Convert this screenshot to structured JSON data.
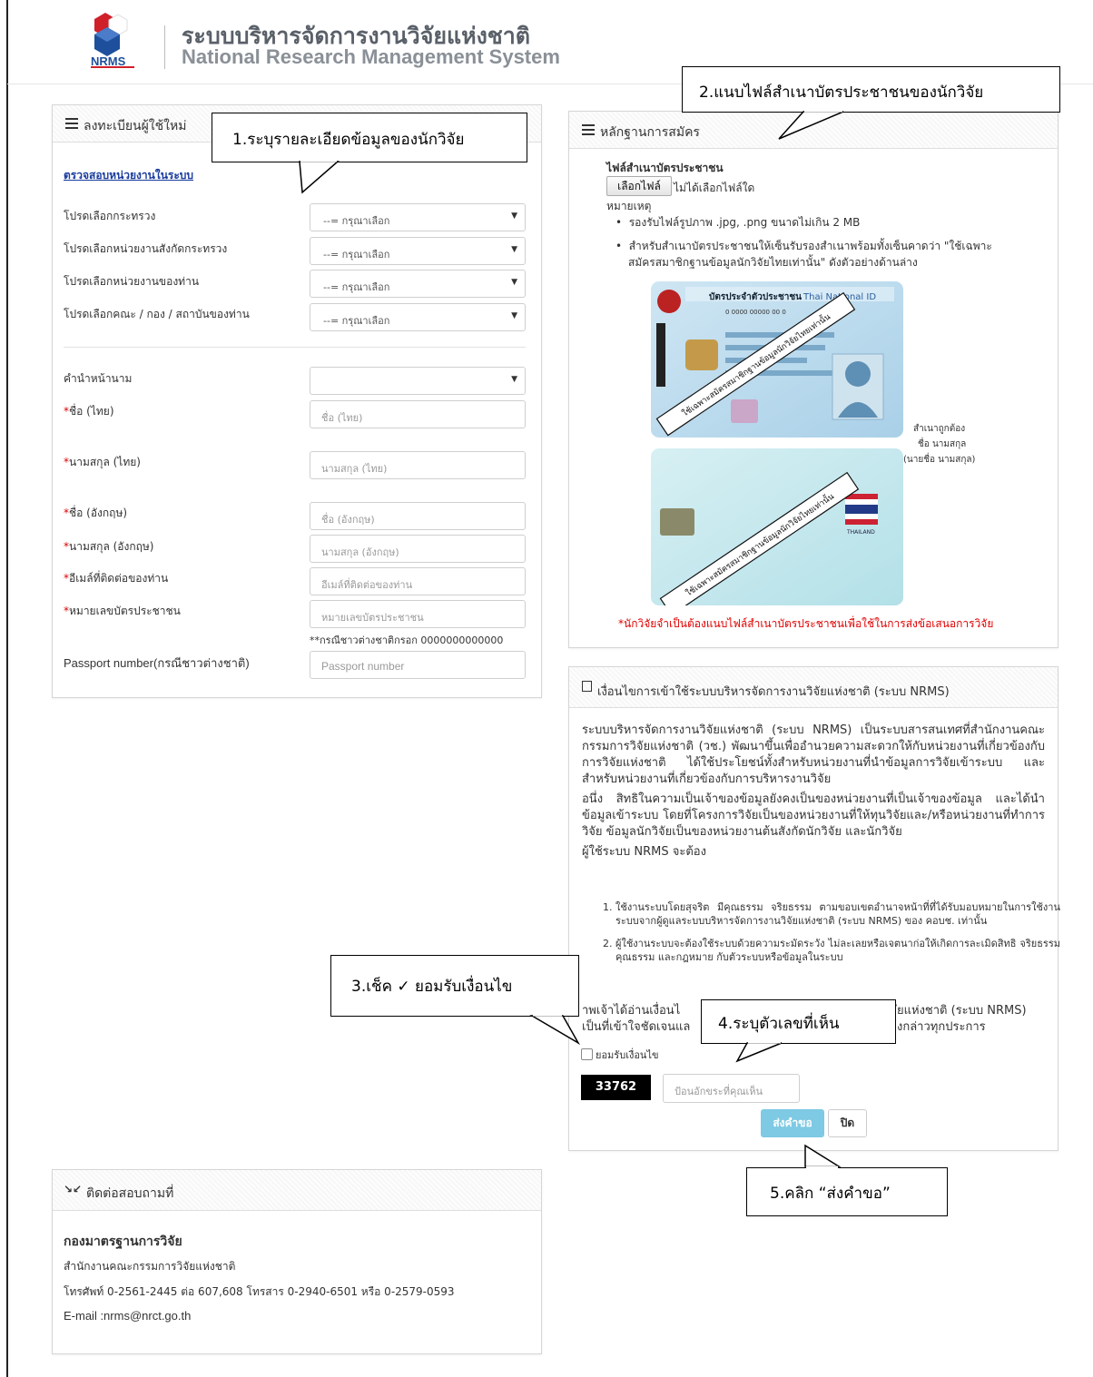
{
  "header": {
    "logo_text": "NRMS",
    "title_th": "ระบบบริหารจัดการงานวิจัยแห่งชาติ",
    "title_en": "National Research Management System"
  },
  "register": {
    "title": "ลงทะเบียนผู้ใช้ใหม่",
    "check_link": "ตรวจสอบหน่วยงานในระบบ",
    "placeholder_select": "--= กรุณาเลือก",
    "ministry_label": "โปรดเลือกกระทรวง",
    "agency_label": "โปรดเลือกหน่วยงานสังกัดกระทรวง",
    "unit_label": "โปรดเลือกหน่วยงานของท่าน",
    "faculty_label": "โปรดเลือกคณะ / กอง / สถาบันของท่าน",
    "prefix_label": "คำนำหน้านาม",
    "required_mark": "*",
    "name_th_label": "ชื่อ (ไทย)",
    "name_th_placeholder": "ชื่อ (ไทย)",
    "surname_th_label": "นามสกุล (ไทย)",
    "surname_th_placeholder": "นามสกุล (ไทย)",
    "name_en_label": "ชื่อ (อังกฤษ)",
    "name_en_placeholder": "ชื่อ (อังกฤษ)",
    "surname_en_label": "นามสกุล (อังกฤษ)",
    "surname_en_placeholder": "นามสกุล (อังกฤษ)",
    "email_label": "อีเมล์ที่ติดต่อของท่าน",
    "email_placeholder": "อีเมล์ที่ติดต่อของท่าน",
    "id_label": "หมายเลขบัตรประชาชน",
    "id_placeholder": "หมายเลขบัตรประชาชน",
    "foreigner_note": "**กรณีชาวต่างชาติกรอก 0000000000000",
    "passport_label": "Passport number(กรณีชาวต่างชาติ)",
    "passport_placeholder": "Passport number"
  },
  "evidence": {
    "title": "หลักฐานการสมัคร",
    "file_label": "ไฟล์สำเนาบัตรประชาชน",
    "choose_file": "เลือกไฟล์",
    "no_file": "ไม่ได้เลือกไฟล์ใด",
    "note_label": "หมายเหตุ",
    "bullet1": "รองรับไฟล์รูปภาพ .jpg, .png ขนาดไม่เกิน 2 MB",
    "bullet2_line1": "สำหรับสำเนาบัตรประชาชนให้เซ็นรับรองสำเนาพร้อมทั้งเซ็นคาดว่า \"ใช้เฉพาะ",
    "bullet2_line2": "สมัครสมาชิกฐานข้อมูลนักวิจัยไทยเท่านั้น\" ดังตัวอย่างด้านล่าง",
    "card_title_th": "บัตรประจำตัวประชาชน",
    "card_title_en": "Thai National ID",
    "card_number": "0 0000 00000 00 0",
    "card_stamp_text": "ใช้เฉพาะสมัครสมาชิกฐานข้อมูลนักวิจัยไทยเท่านั้น",
    "card_country": "THAILAND",
    "sign_line1": "สำเนาถูกต้อง",
    "sign_line2": "ชื่อ นามสกุล",
    "sign_line3": "(นายชื่อ นามสกุล)",
    "warning": "*นักวิจัยจำเป็นต้องแนบไฟล์สำเนาบัตรประชาชนเพื่อใช้ในการส่งข้อเสนอการวิจัย"
  },
  "terms": {
    "title": "เงื่อนไขการเข้าใช้ระบบบริหารจัดการงานวิจัยแห่งชาติ (ระบบ NRMS)",
    "p1": "ระบบบริหารจัดการงานวิจัยแห่งชาติ (ระบบ NRMS) เป็นระบบสารสนเทศที่สำนักงานคณะกรรมการวิจัยแห่งชาติ (วช.) พัฒนาขึ้นเพื่ออำนวยความสะดวกให้กับหน่วยงานที่เกี่ยวข้องกับการวิจัยแห่งชาติ ได้ใช้ประโยชน์ทั้งสำหรับหน่วยงานที่นำข้อมูลการวิจัยเข้าระบบ และสำหรับหน่วยงานที่เกี่ยวข้องกับการบริหารงานวิจัย",
    "p2": "อนึ่ง สิทธิในความเป็นเจ้าของข้อมูลยังคงเป็นของหน่วยงานที่เป็นเจ้าของข้อมูล และได้นำข้อมูลเข้าระบบ โดยที่โครงการวิจัยเป็นของหน่วยงานที่ให้ทุนวิจัยและ/หรือหน่วยงานที่ทำการวิจัย ข้อมูลนักวิจัยเป็นของหน่วยงานต้นสังกัดนักวิจัย และนักวิจัย",
    "p3": "ผู้ใช้ระบบ NRMS จะต้อง",
    "item1": "ใช้งานระบบโดยสุจริต มีคุณธรรม จริยธรรม ตามขอบเขตอำนาจหน้าที่ที่ได้รับมอบหมายในการใช้งานระบบจากผู้ดูแลระบบบริหารจัดการงานวิจัยแห่งชาติ (ระบบ NRMS) ของ คอบช. เท่านั้น",
    "item2": "ผู้ใช้งานระบบจะต้องใช้ระบบด้วยความระมัดระวัง ไม่ละเลยหรือเจตนาก่อให้เกิดการละเมิดสิทธิ จริยธรรม คุณธรรม และกฎหมาย กับตัวระบบหรือข้อมูลในระบบ",
    "p4_left1": "าพเจ้าได้อ่านเงื่อนไ",
    "p4_right1": "ัยแห่งชาติ (ระบบ NRMS)",
    "p4_left2": "เป็นที่เข้าใจชัดเจนแล",
    "p4_right2": "งกล่าวทุกประการ",
    "accept_label": "ยอมรับเงื่อนไข",
    "captcha": "33762",
    "captcha_placeholder": "ป้อนอักขระที่คุณเห็น",
    "submit": "ส่งคำขอ",
    "close": "ปิด"
  },
  "contact": {
    "title": "ติดต่อสอบถามที่",
    "org": "กองมาตรฐานการวิจัย",
    "office": "สำนักงานคณะกรรมการวิจัยแห่งชาติ",
    "phone": "โทรศัพท์ 0-2561-2445 ต่อ 607,608 โทรสาร 0-2940-6501 หรือ 0-2579-0593",
    "email": "E-mail :nrms@nrct.go.th"
  },
  "callouts": {
    "c1": "1.ระบุรายละเอียดข้อมูลของนักวิจัย",
    "c2": "2.แนบไฟล์สำเนาบัตรประชาชนของนักวิจัย",
    "c3": "3.เช็ค ✓ ยอมรับเงื่อนไข",
    "c4": "4.ระบุตัวเลขที่เห็น",
    "c5": "5.คลิก “ส่งคำขอ”"
  }
}
